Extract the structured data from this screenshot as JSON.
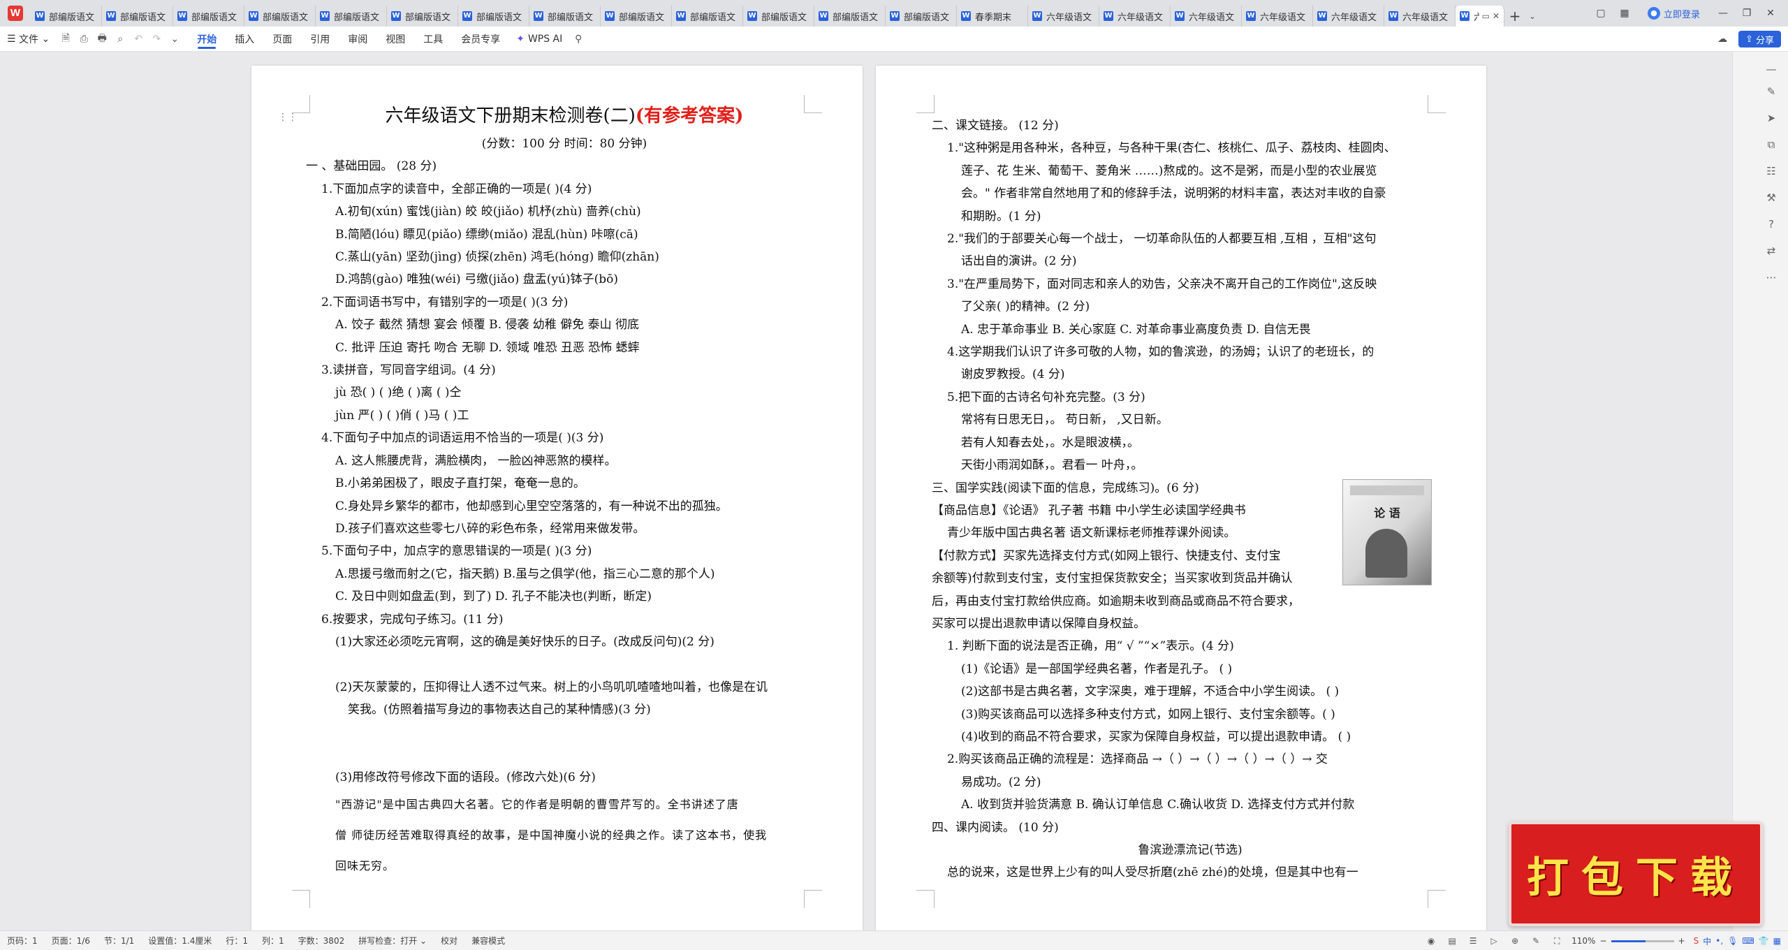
{
  "app": {
    "logo": "W"
  },
  "tabs": [
    {
      "label": "部编版语文",
      "icon": "doc-icon"
    },
    {
      "label": "部编版语文",
      "icon": "doc-icon"
    },
    {
      "label": "部编版语文",
      "icon": "doc-icon"
    },
    {
      "label": "部编版语文",
      "icon": "doc-icon"
    },
    {
      "label": "部编版语文",
      "icon": "doc-icon"
    },
    {
      "label": "部编版语文",
      "icon": "doc-icon"
    },
    {
      "label": "部编版语文",
      "icon": "doc-icon"
    },
    {
      "label": "部编版语文",
      "icon": "doc-icon"
    },
    {
      "label": "部编版语文",
      "icon": "doc-icon"
    },
    {
      "label": "部编版语文",
      "icon": "doc-icon"
    },
    {
      "label": "部编版语文",
      "icon": "doc-icon"
    },
    {
      "label": "部编版语文",
      "icon": "doc-icon"
    },
    {
      "label": "部编版语文",
      "icon": "doc-icon"
    },
    {
      "label": "春季期末",
      "icon": "doc-icon"
    },
    {
      "label": "六年级语文",
      "icon": "doc-icon"
    },
    {
      "label": "六年级语文",
      "icon": "doc-icon"
    },
    {
      "label": "六年级语文",
      "icon": "doc-icon"
    },
    {
      "label": "六年级语文",
      "icon": "doc-icon"
    },
    {
      "label": "六年级语文",
      "icon": "doc-icon"
    },
    {
      "label": "六年级语文",
      "icon": "doc-icon"
    }
  ],
  "active_tab": {
    "label": "六年"
  },
  "titlebar": {
    "login": "立即登录"
  },
  "ribbon": {
    "file": "文件",
    "tabs": [
      "开始",
      "插入",
      "页面",
      "引用",
      "审阅",
      "视图",
      "工具",
      "会员专享"
    ],
    "wps_ai": "WPS AI",
    "share": "分享"
  },
  "page1": {
    "title": "六年级语文下册期末检测卷(二)",
    "title_note": "(有参考答案)",
    "subtitle": "(分数：100 分      时间：80 分钟)",
    "lines": [
      "一 、基础田园。 (28 分)",
      "1.下面加点字的读音中，全部正确的一项是(      )(4 分)",
      "A.初旬(xún)        蜜饯(jiàn)        皎 皎(jiǎo)        机杼(zhù)        啬养(chù)",
      "B.简陋(lóu)        瞟见(piǎo)        缥缈(miǎo)        混乱(hùn)        咔嚓(cā)",
      "C.蒸山(yān)        坚劲(jìng)        侦探(zhēn)        鸿毛(hóng)        瞻仰(zhān)",
      "D.鸿鹄(gào)        唯独(wéi)        弓缴(jiǎo)        盘盂(yú)钵子(bō)",
      "2.下面词语书写中，有错别字的一项是(      )(3 分)",
      "A. 饺子   截然   猜想   宴会   倾覆               B. 侵袭   幼稚   僻免   泰山   彻底",
      "C. 批评   压迫   寄托   吻合   无聊               D. 领域   唯恐   丑恶   恐怖   蟋蟀",
      "3.读拼音，写同音字组词。(4 分)",
      "jù  恐(          )      (          )绝      (          )离      (          )仝",
      "jùn 严(          )      (          )俏      (          )马      (          )工",
      "4.下面句子中加点的词语运用不恰当的一项是(      )(3 分)",
      "A. 这人熊腰虎背，满脸横肉，  一脸凶神恶煞的模样。",
      "B.小弟弟困极了，眼皮子直打架，奄奄一息的。",
      "C.身处异乡繁华的都市，他却感到心里空空落落的，有一种说不出的孤独。",
      "D.孩子们喜欢这些零七八碎的彩色布条，经常用来做发带。",
      "5.下面句子中，加点字的意思错误的一项是(      )(3 分)",
      "A.思援弓缴而射之(它，指天鹅)      B.虽与之俱学(他，指三心二意的那个人)",
      "C. 及日中则如盘盂(到，到了)           D. 孔子不能决也(判断，断定)",
      "6.按要求，完成句子练习。(11 分)",
      "(1)大家还必须吃元宵啊，这的确是美好快乐的日子。(改成反问句)(2 分)",
      "",
      "(2)天灰蒙蒙的，压抑得让人透不过气来。树上的小鸟叽叽喳喳地叫着，也像是在讥",
      "笑我。(仿照着描写身边的事物表达自己的某种情感)(3 分)",
      "",
      "",
      "(3)用修改符号修改下面的语段。(修改六处)(6 分)",
      "\"西游记\"是中国古典四大名著。它的作者是明朝的曹雪芹写的。全书讲述了唐",
      "僧 师徒历经苦难取得真经的故事，是中国神魔小说的经典之作。读了这本书，使我",
      "回味无穷。"
    ]
  },
  "page2": {
    "lines": [
      "二、课文链接。 (12 分)",
      "1.\"这种粥是用各种米，各种豆，与各种干果(杏仁、核桃仁、瓜子、荔枝肉、桂圆肉、",
      "莲子、花 生米、葡萄干、菱角米 ……)熬成的。这不是粥，而是小型的农业展览",
      "会。\" 作者非常自然地用了和的修辞手法，说明粥的材料丰富，表达对丰收的自豪",
      "和期盼。(1 分)",
      "2.\"我们的于部要关心每一个战士， 一切革命队伍的人都要互相 ,互相 ，互相\"这句",
      "话出自的演讲。(2 分)",
      "3.\"在严重局势下，面对同志和亲人的劝告，父亲决不离开自己的工作岗位\",这反映",
      "了父亲(      )的精神。(2 分)",
      "A. 忠于革命事业      B. 关心家庭      C. 对革命事业高度负责      D. 自信无畏",
      "4.这学期我们认识了许多可敬的人物，如的鲁滨逊，的汤姆；认识了的老班长，的",
      "谢皮罗教授。(4 分)",
      "5.把下面的古诗名句补充完整。(3 分)",
      "常将有日思无日，。       苟日新，   ,又日新。",
      "若有人知春去处，。水是眼波横，。",
      "天街小雨润如酥，。君看一 叶舟，。",
      "三、国学实践(阅读下面的信息，完成练习)。(6 分)",
      "【商品信息】《论语》   孔子著    书籍   中小学生必读国学经典书",
      "青少年版中国古典名著    语文新课标老师推荐课外阅读。",
      "【付款方式】买家先选择支付方式(如网上银行、快捷支付、支付宝",
      "余额等)付款到支付宝，支付宝担保货款安全；当买家收到货品并确认",
      "后，再由支付宝打款给供应商。如逾期未收到商品或商品不符合要求，",
      "买家可以提出退款申请以保障自身权益。",
      "1. 判断下面的说法是否正确，用“ √ ”“×”表示。(4 分)",
      "(1)《论语》是一部国学经典名著，作者是孔子。                              (          )",
      "(2)这部书是古典名著，文字深奥，难于理解，不适合中小学生阅读。      (          )",
      "(3)购买该商品可以选择多种支付方式，如网上银行、支付宝余额等。(      )",
      "(4)收到的商品不符合要求，买家为保障自身权益，可以提出退款申请。      (      )",
      "2.购买该商品正确的流程是：选择商品 →（    ）→（     ）→（     ）→（     ）→ 交",
      "易成功。(2 分)",
      "A. 收到货并验货满意    B. 确认订单信息    C.确认收货    D. 选择支付方式并付款",
      "四、课内阅读。 (10 分)",
      "鲁滨逊漂流记(节选)",
      "总的说来，这是世界上少有的叫人受尽折磨(zhē  zhé)的处境，但是其中也有一"
    ],
    "book_cover": {
      "title": "论 语"
    }
  },
  "promo": {
    "text": "打包下载"
  },
  "status": {
    "page_num": "页码：1",
    "pages": "页面：1/6",
    "section": "节：1/1",
    "position": "设置值：1.4厘米",
    "row": "行：1",
    "col": "列：1",
    "words": "字数：3802",
    "spell": "拼写检查：打开",
    "proof": "校对",
    "compat": "兼容模式",
    "zoom": "110%",
    "zoom_level": 0.55,
    "ime": "中"
  },
  "colors": {
    "accent": "#2b62d9",
    "title_red": "#e0201b",
    "promo_red": "#d81e1e",
    "promo_text": "#ffe44a"
  }
}
